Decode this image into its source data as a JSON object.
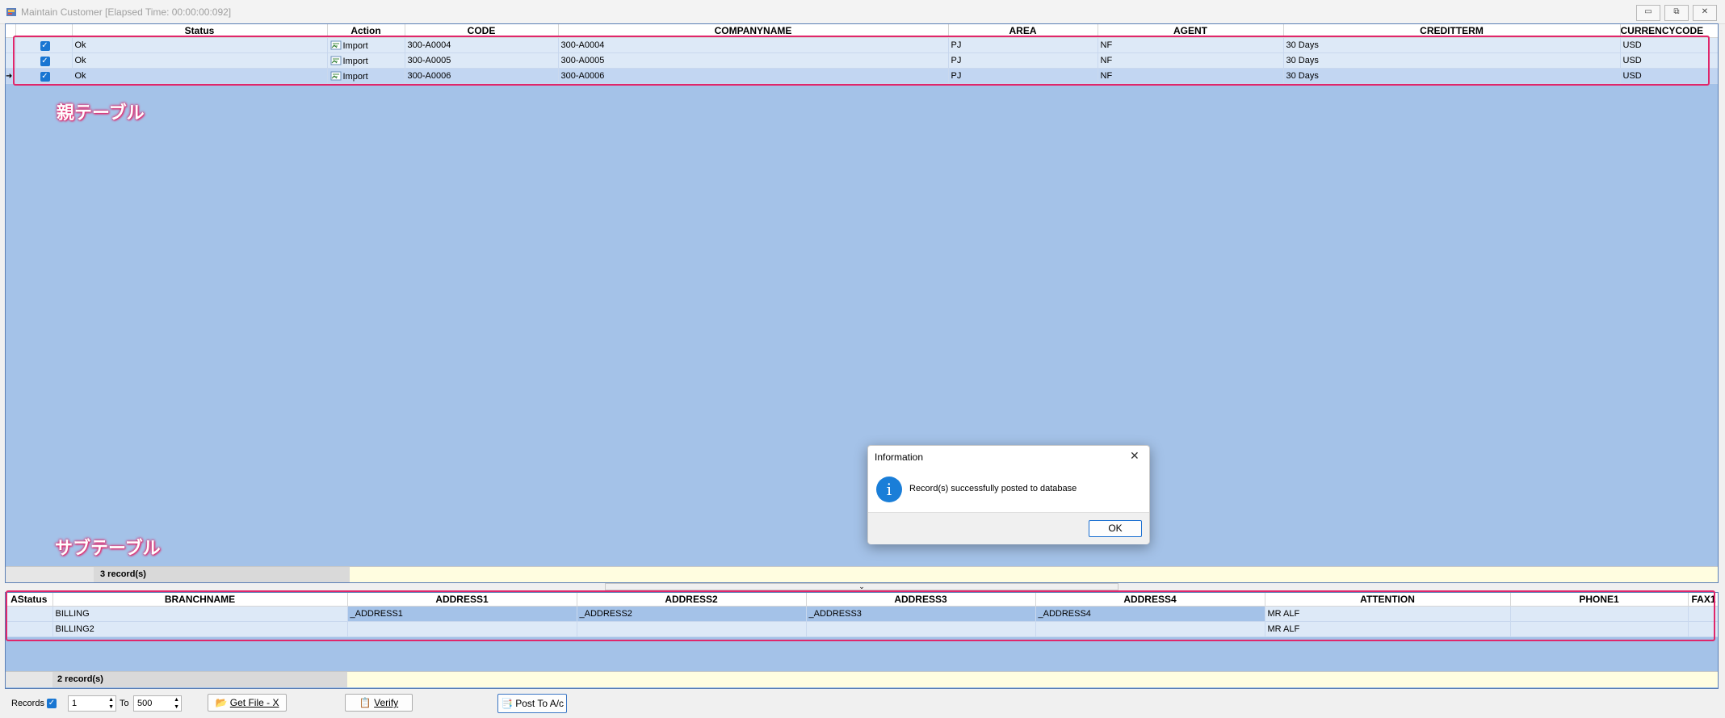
{
  "window": {
    "title": "Maintain Customer [Elapsed Time: 00:00:00:092]",
    "buttons": {
      "minimize": "▭",
      "restore": "⧉",
      "close": "✕"
    }
  },
  "parent_table": {
    "annotation": "親テーブル",
    "columns": [
      "Status",
      "Action",
      "CODE",
      "COMPANYNAME",
      "AREA",
      "AGENT",
      "CREDITTERM",
      "CURRENCYCODE"
    ],
    "rows": [
      {
        "status": "Ok",
        "action": "Import",
        "code": "300-A0004",
        "companyname": "300-A0004",
        "area": "PJ",
        "agent": "NF",
        "creditterm": "30 Days",
        "currency": "USD"
      },
      {
        "status": "Ok",
        "action": "Import",
        "code": "300-A0005",
        "companyname": "300-A0005",
        "area": "PJ",
        "agent": "NF",
        "creditterm": "30 Days",
        "currency": "USD"
      },
      {
        "status": "Ok",
        "action": "Import",
        "code": "300-A0006",
        "companyname": "300-A0006",
        "area": "PJ",
        "agent": "NF",
        "creditterm": "30 Days",
        "currency": "USD"
      }
    ],
    "footer": "3 record(s)"
  },
  "sub_table": {
    "annotation": "サブテーブル",
    "columns": [
      "AStatus",
      "BRANCHNAME",
      "ADDRESS1",
      "ADDRESS2",
      "ADDRESS3",
      "ADDRESS4",
      "ATTENTION",
      "PHONE1",
      "FAX1"
    ],
    "rows": [
      {
        "astatus": "",
        "branchname": "BILLING",
        "address1": "_ADDRESS1",
        "address2": "_ADDRESS2",
        "address3": "_ADDRESS3",
        "address4": "_ADDRESS4",
        "attention": "MR ALF",
        "phone1": "",
        "fax1": ""
      },
      {
        "astatus": "",
        "branchname": "BILLING2",
        "address1": "",
        "address2": "",
        "address3": "",
        "address4": "",
        "attention": "MR ALF",
        "phone1": "",
        "fax1": ""
      }
    ],
    "footer": "2 record(s)"
  },
  "dialog": {
    "title": "Information",
    "message": "Record(s) successfully posted to database",
    "ok_label": "OK",
    "close_glyph": "✕",
    "info_glyph": "i"
  },
  "bottom_bar": {
    "records_label": "Records",
    "from_value": "1",
    "to_label": "To",
    "to_value": "500",
    "get_file_label": "Get File - X",
    "verify_label": "Verify",
    "post_label": "Post To A/c"
  },
  "colors": {
    "grid_bg": "#a4c2e8",
    "annotation": "#e0266b",
    "checkbox": "#1976d2"
  }
}
